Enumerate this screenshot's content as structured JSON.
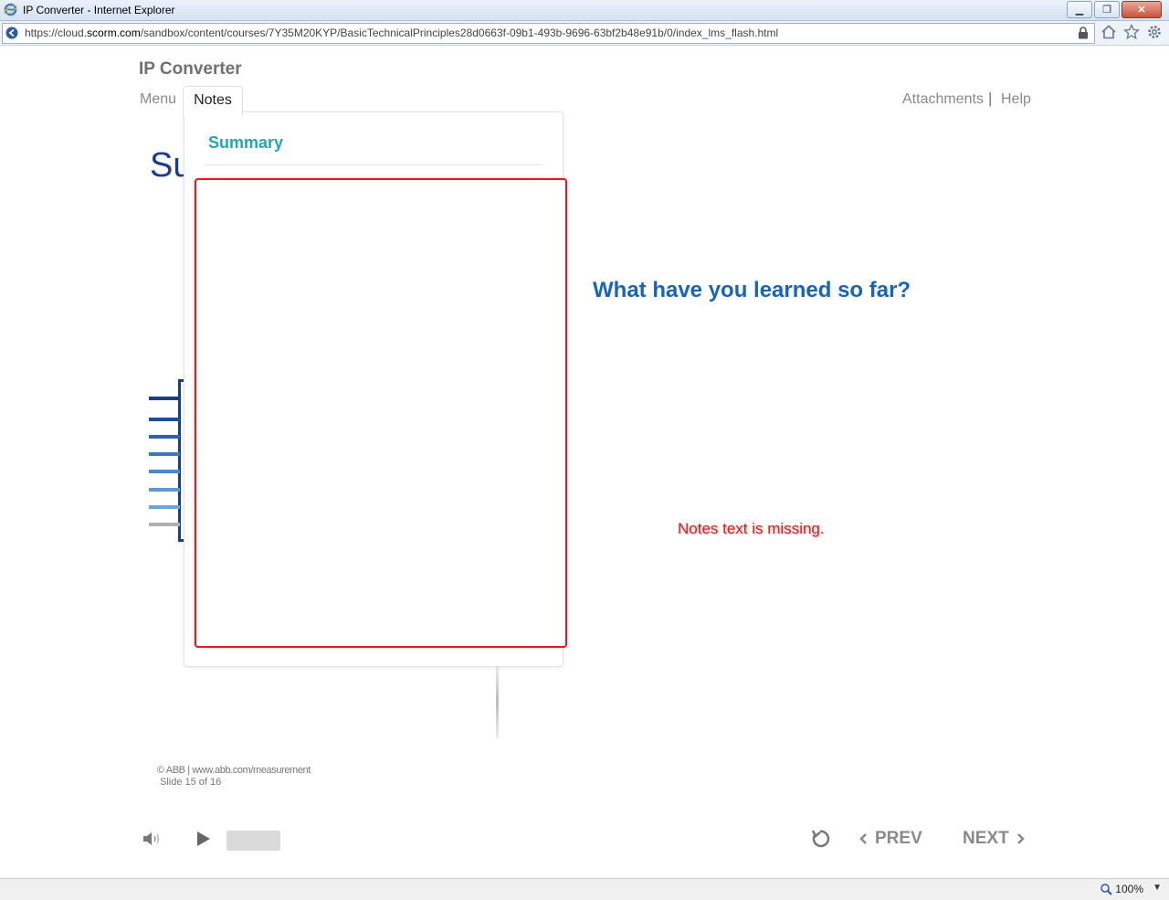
{
  "window": {
    "title": "IP Converter - Internet Explorer"
  },
  "address": {
    "url_prefix": "https://cloud.",
    "url_domain": "scorm.com",
    "url_path": "/sandbox/content/courses/7Y35M20KYP/BasicTechnicalPrinciples28d0663f-09b1-493b-9696-63bf2b48e91b/0/index_lms_flash.html"
  },
  "course": {
    "title": "IP Converter",
    "nav": {
      "menu": "Menu",
      "notes": "Notes",
      "attachments": "Attachments",
      "separator": "|",
      "help": "Help"
    }
  },
  "slide": {
    "heading": "Su",
    "question": "What have you learned so far?"
  },
  "notes_panel": {
    "title": "Summary",
    "body": ""
  },
  "annotation": "Notes text is missing.",
  "footer": {
    "copyright": "© ABB | www.abb.com/measurement",
    "slide_count": "Slide 15 of 16"
  },
  "player": {
    "prev": "PREV",
    "next": "NEXT"
  },
  "statusbar": {
    "zoom": "100%"
  },
  "colors": {
    "accent_teal": "#22a8b0",
    "heading_blue": "#1565c0",
    "annotation_red": "#e31b1b"
  }
}
